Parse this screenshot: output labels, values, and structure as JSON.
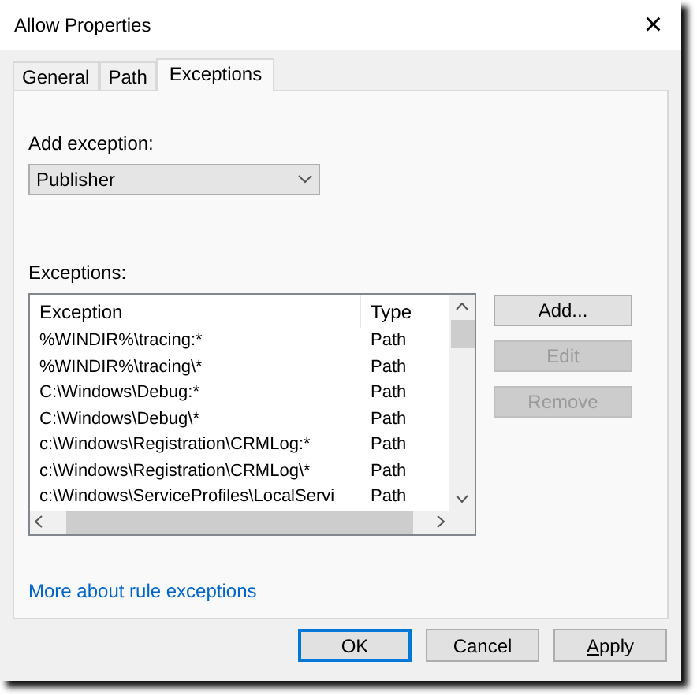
{
  "window": {
    "title": "Allow Properties",
    "close": "×"
  },
  "tabs": [
    {
      "label": "General",
      "selected": false
    },
    {
      "label": "Path",
      "selected": false
    },
    {
      "label": "Exceptions",
      "selected": true
    }
  ],
  "add_exception": {
    "label": "Add exception:",
    "value": "Publisher"
  },
  "exceptions": {
    "label": "Exceptions:",
    "columns": [
      "Exception",
      "Type"
    ],
    "rows": [
      [
        "%WINDIR%\\tracing:*",
        "Path"
      ],
      [
        "%WINDIR%\\tracing\\*",
        "Path"
      ],
      [
        "C:\\Windows\\Debug:*",
        "Path"
      ],
      [
        "C:\\Windows\\Debug\\*",
        "Path"
      ],
      [
        "c:\\Windows\\Registration\\CRMLog:*",
        "Path"
      ],
      [
        "c:\\Windows\\Registration\\CRMLog\\*",
        "Path"
      ],
      [
        "c:\\Windows\\ServiceProfiles\\LocalServi",
        "Path"
      ]
    ]
  },
  "side_buttons": [
    {
      "label": "Add...",
      "disabled": false
    },
    {
      "label": "Edit",
      "disabled": true
    },
    {
      "label": "Remove",
      "disabled": true
    }
  ],
  "link": "More about rule exceptions",
  "footer_buttons": [
    {
      "label": "OK",
      "default": true,
      "access_key": false
    },
    {
      "label": "Cancel",
      "default": false,
      "access_key": false
    },
    {
      "label": "Apply",
      "default": false,
      "access_key": true
    }
  ]
}
